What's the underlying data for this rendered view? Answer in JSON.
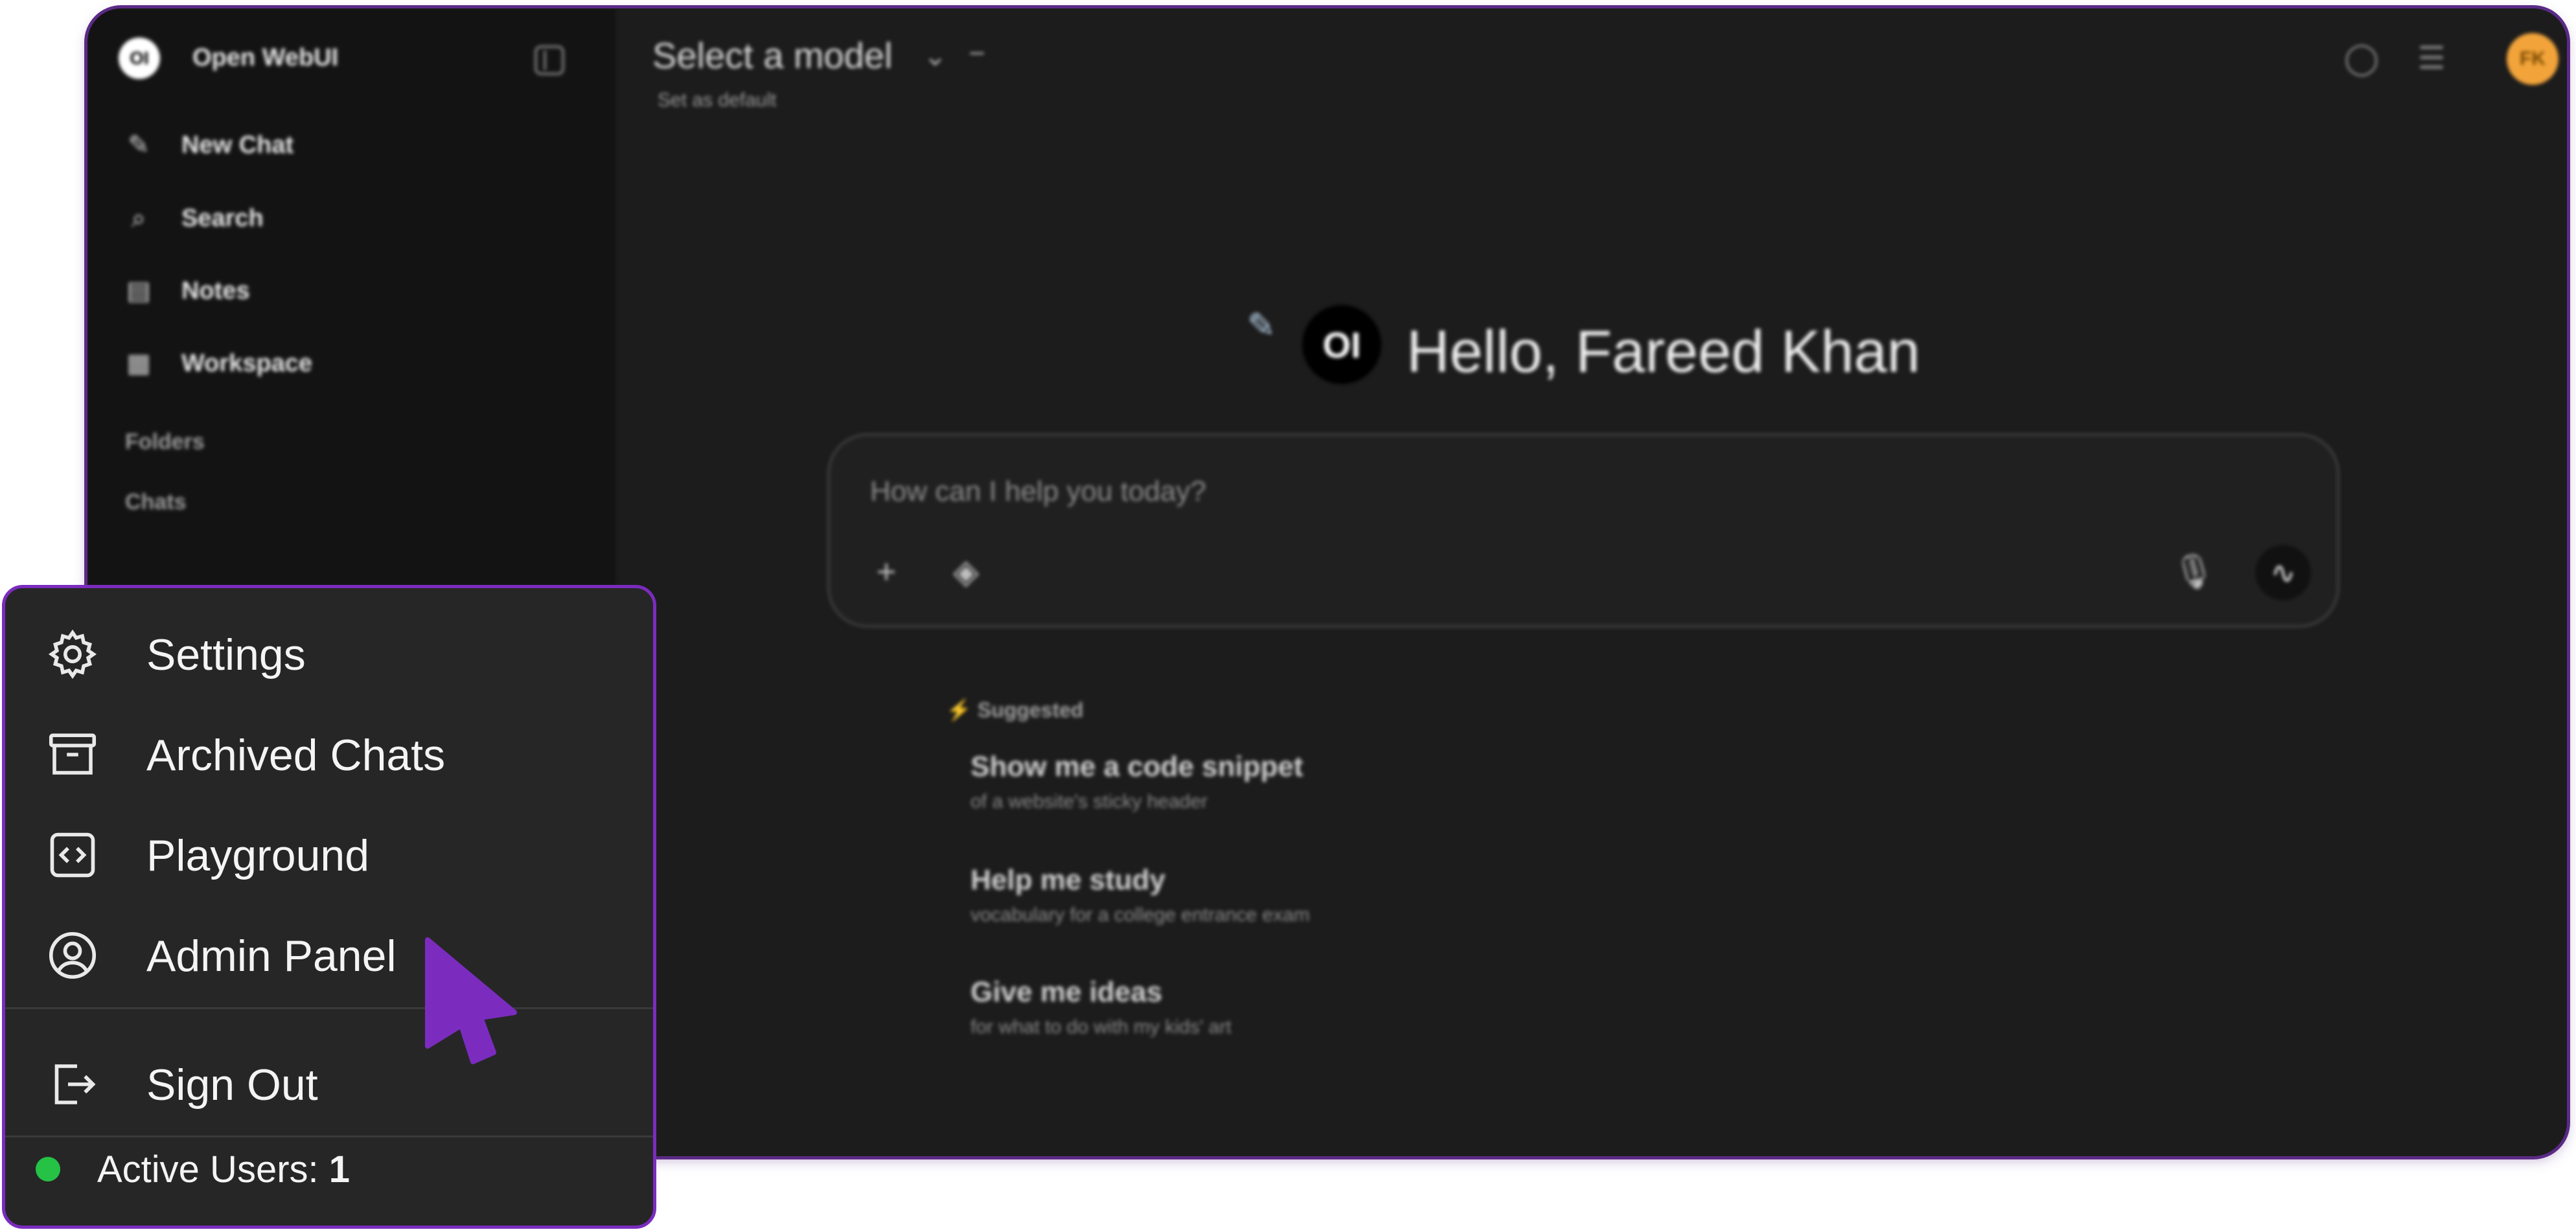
{
  "sidebar": {
    "brand_logo": "OI",
    "brand_name": "Open WebUI",
    "items": [
      {
        "label": "New Chat",
        "icon": "edit-icon"
      },
      {
        "label": "Search",
        "icon": "search-icon"
      },
      {
        "label": "Notes",
        "icon": "notes-icon"
      },
      {
        "label": "Workspace",
        "icon": "grid-icon"
      }
    ],
    "sections": [
      "Folders",
      "Chats"
    ]
  },
  "header": {
    "model_selector": "Select a model",
    "set_default": "Set as default",
    "user_initials": "FK"
  },
  "main": {
    "greeting": "Hello, Fareed Khan",
    "logo_text": "OI",
    "input_placeholder": "How can I help you today?",
    "suggested_label": "Suggested",
    "suggestions": [
      {
        "title": "Show me a code snippet",
        "subtitle": "of a website's sticky header"
      },
      {
        "title": "Help me study",
        "subtitle": "vocabulary for a college entrance exam"
      },
      {
        "title": "Give me ideas",
        "subtitle": "for what to do with my kids' art"
      }
    ]
  },
  "user_menu": {
    "items": [
      {
        "label": "Settings",
        "icon": "gear-icon"
      },
      {
        "label": "Archived Chats",
        "icon": "archive-icon"
      },
      {
        "label": "Playground",
        "icon": "code-icon"
      },
      {
        "label": "Admin Panel",
        "icon": "user-circle-icon"
      }
    ],
    "sign_out": {
      "label": "Sign Out",
      "icon": "sign-out-icon"
    },
    "active_users_label": "Active Users:",
    "active_users_count": "1"
  },
  "colors": {
    "menu_border": "#7b2cbf",
    "cursor": "#7b2cbf",
    "active_dot": "#26c246",
    "avatar": "#f2a43a"
  }
}
